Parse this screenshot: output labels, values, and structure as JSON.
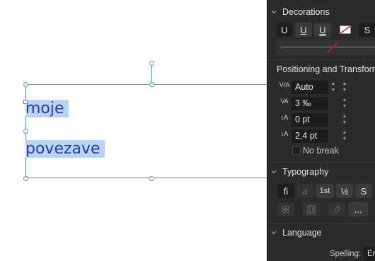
{
  "canvas": {
    "text_lines": [
      "moje",
      "povezave"
    ]
  },
  "panel": {
    "decorations": {
      "title": "Decorations",
      "buttons": [
        "U",
        "U",
        "U",
        "",
        "S"
      ]
    },
    "positioning": {
      "title": "Positioning and Transform",
      "fields": [
        {
          "icon": "V/A",
          "value": "Auto"
        },
        {
          "icon": "VA",
          "value": "3 ‰"
        },
        {
          "icon": "↕A",
          "value": "0 pt"
        },
        {
          "icon": "↕A",
          "value": "2,4 pt"
        }
      ],
      "no_break_label": "No break"
    },
    "typography": {
      "title": "Typography",
      "row1": [
        "fi",
        "a",
        "1st",
        "½",
        "S"
      ],
      "more_label": "..."
    },
    "language": {
      "title": "Language",
      "spelling_label": "Spelling:",
      "spelling_value": "En"
    }
  },
  "colors": {
    "selection": "#b9d3f3",
    "text": "#2a3da8",
    "panel_bg": "#2b2b2b",
    "bbox": "#5a8fd6"
  }
}
